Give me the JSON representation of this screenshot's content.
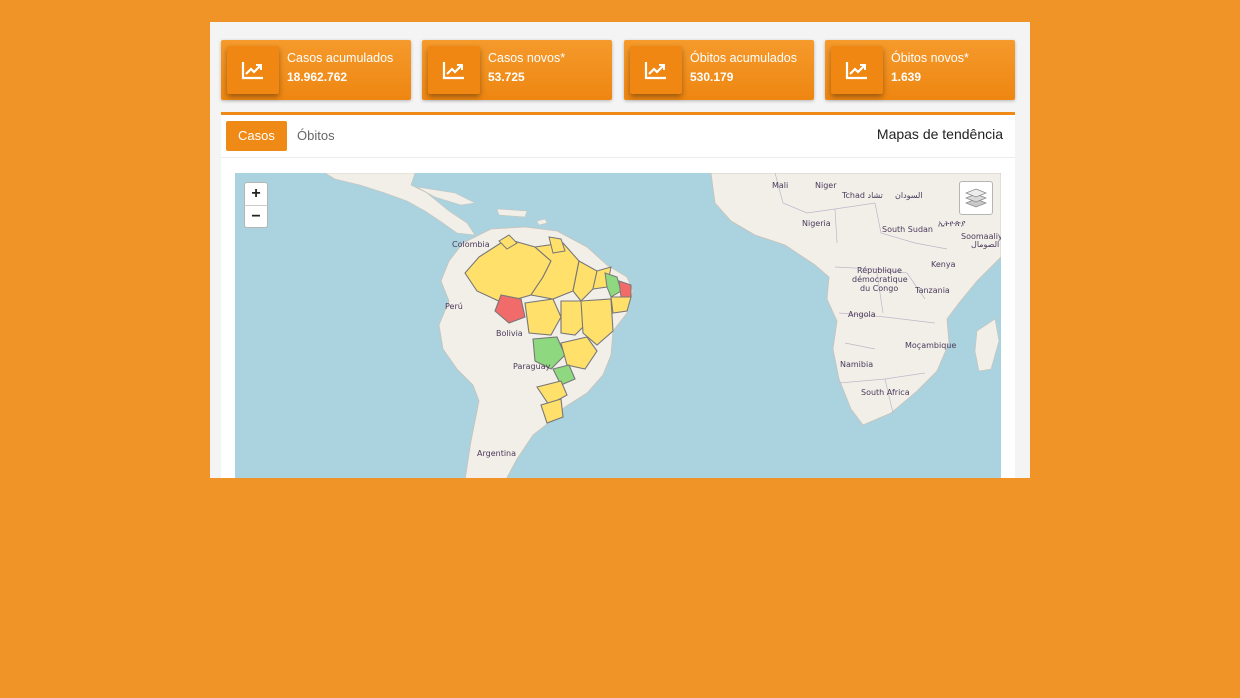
{
  "stats": [
    {
      "label": "Casos acumulados",
      "value": "18.962.762",
      "icon": "trending-up-icon"
    },
    {
      "label": "Casos novos*",
      "value": "53.725",
      "icon": "trending-up-icon"
    },
    {
      "label": "Óbitos acumulados",
      "value": "530.179",
      "icon": "trending-up-icon"
    },
    {
      "label": "Óbitos novos*",
      "value": "1.639",
      "icon": "trending-up-icon"
    }
  ],
  "tabs": {
    "active": "Casos",
    "inactive": "Óbitos"
  },
  "trend_title": "Mapas de tendência",
  "map": {
    "zoom_in": "+",
    "zoom_out": "−",
    "layers_icon": "layers-icon",
    "labels": {
      "colombia": "Colombia",
      "peru": "Perú",
      "bolivia": "Bolivia",
      "paraguay": "Paraguay",
      "argentina": "Argentina",
      "mali": "Mali",
      "niger": "Niger",
      "tchad": "Tchad تشاد",
      "sudan": "السودان",
      "nigeria": "Nigeria",
      "south_sudan": "South Sudan",
      "ethiopia": "ኢትዮጵያ",
      "somalia": "Soomaaliya",
      "somalia_ar": "الصومال",
      "kenya": "Kenya",
      "drc1": "République",
      "drc2": "démocratique",
      "drc3": "du Congo",
      "tanzania": "Tanzania",
      "angola": "Angola",
      "mocambique": "Moçambique",
      "namibia": "Namibia",
      "south_africa": "South Africa"
    },
    "colors": {
      "water": "#aad3df",
      "land": "#f2efe9",
      "yellow": "#ffe06b",
      "green": "#8ed97f",
      "red": "#f26b6b",
      "accent": "#F09427"
    }
  }
}
